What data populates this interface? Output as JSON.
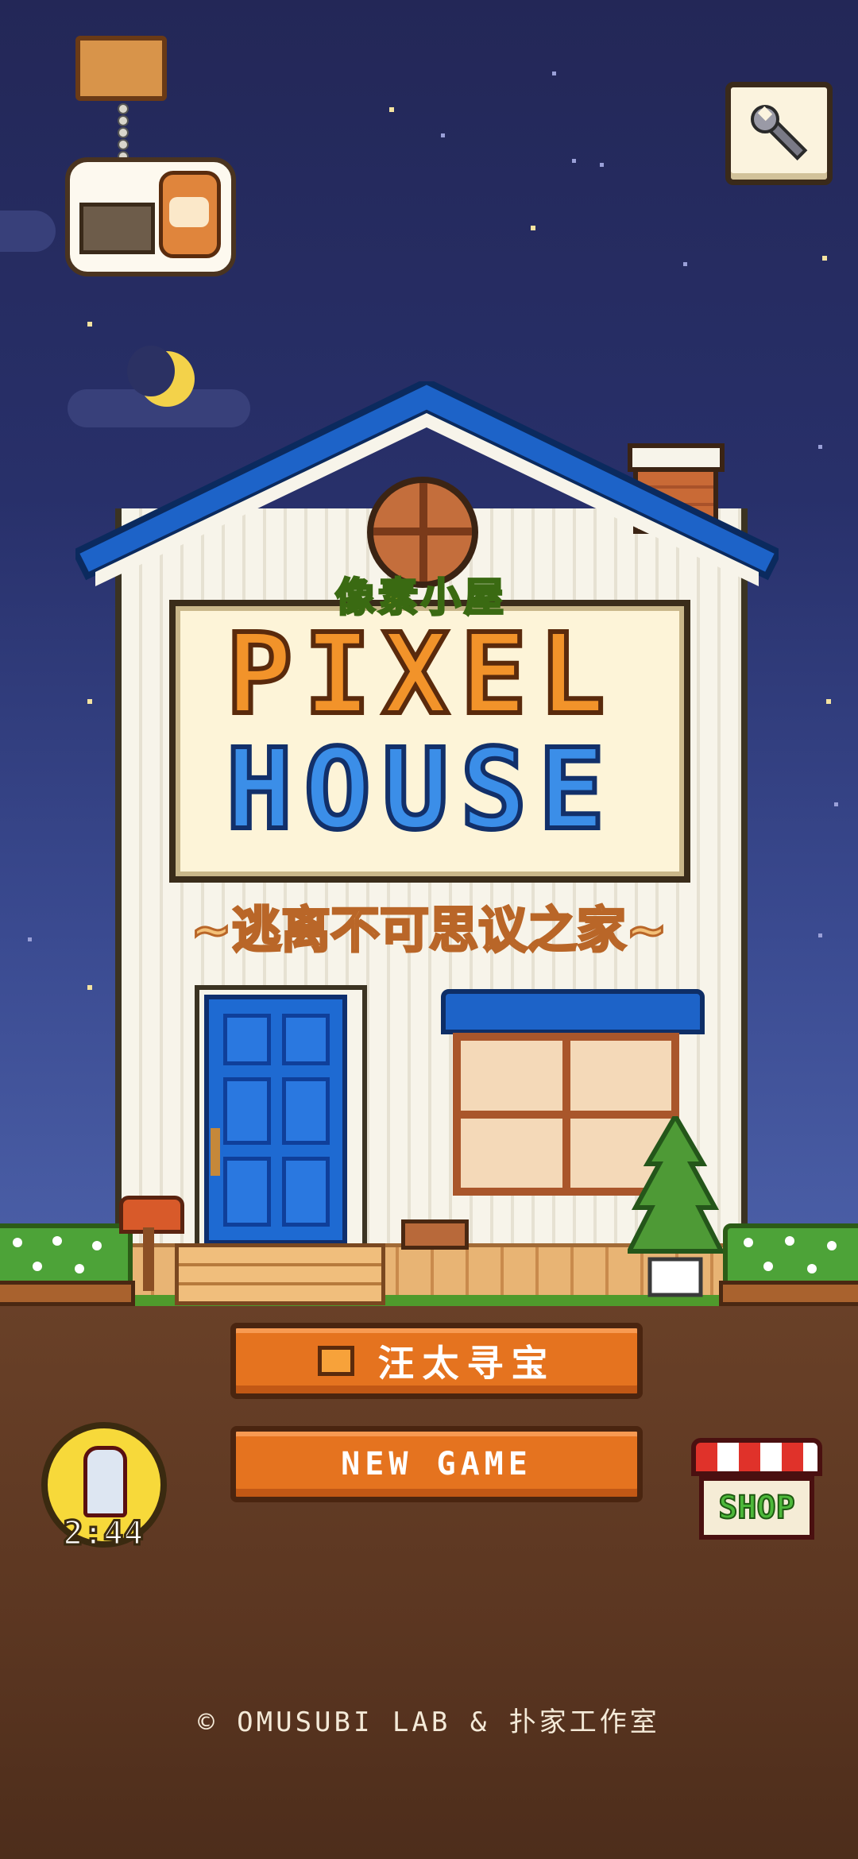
{
  "game": {
    "title_cn": "像素小屋",
    "title_line1": "PIXEL",
    "title_line2": "HOUSE",
    "subtitle": "~逃离不可思议之家~"
  },
  "menu": {
    "treasure_label": "汪太寻宝",
    "new_game_label": "NEW GAME"
  },
  "capsule": {
    "timer": "2:44",
    "icon": "gacha-machine-icon"
  },
  "shop": {
    "label": "SHOP",
    "icon": "shop-stall-icon"
  },
  "settings": {
    "icon": "wrench-icon"
  },
  "footer": {
    "copyright": "© OMUSUBI LAB & 扑家工作室"
  },
  "colors": {
    "sky": "#28306a",
    "roof": "#1d63c8",
    "button": "#e5731f",
    "door": "#1e6ad2",
    "ground": "#5b3621"
  }
}
